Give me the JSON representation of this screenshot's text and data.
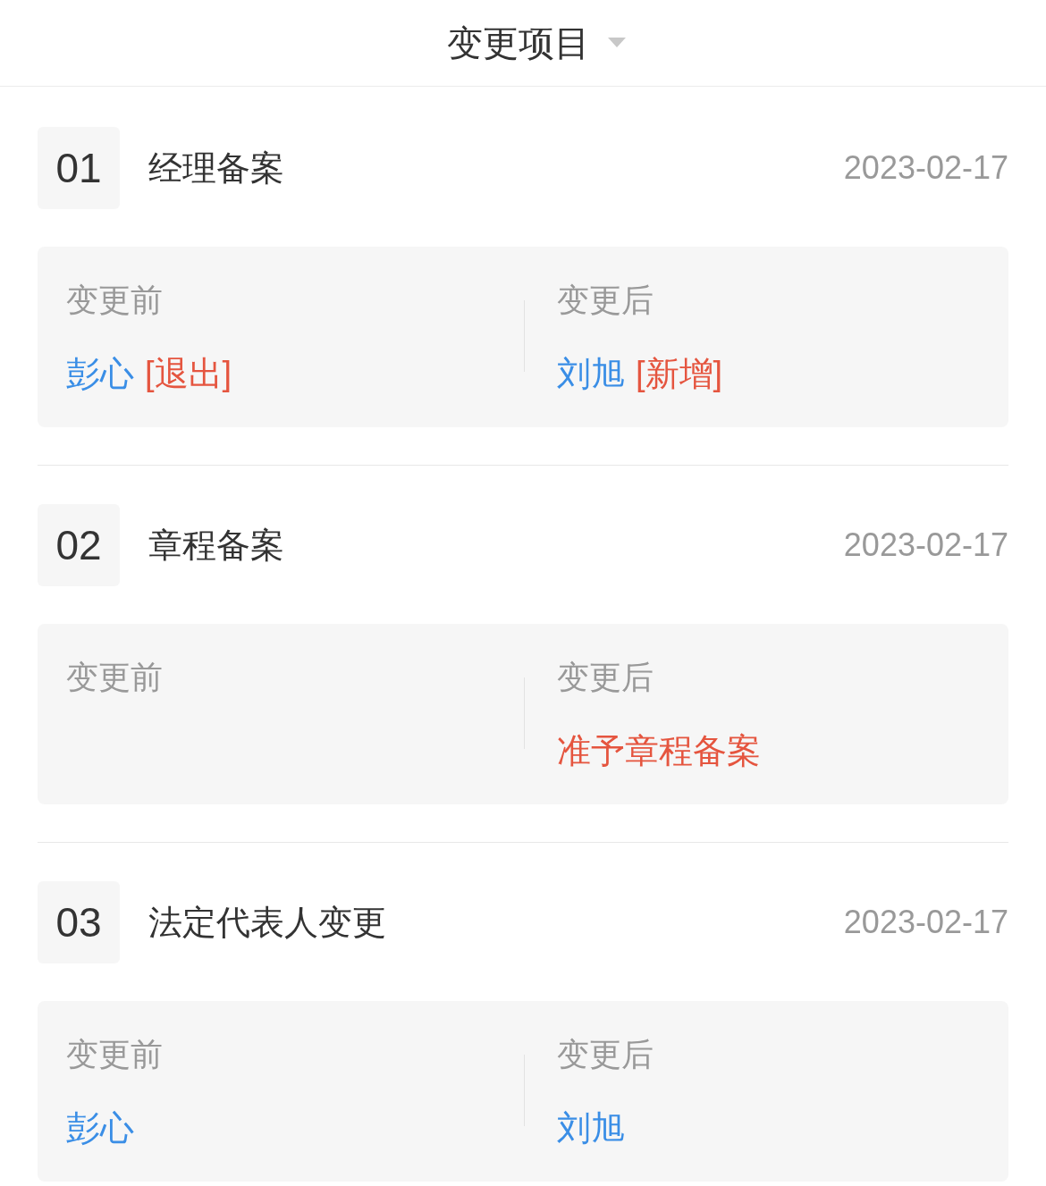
{
  "header": {
    "title": "变更项目"
  },
  "items": [
    {
      "number": "01",
      "title": "经理备案",
      "date": "2023-02-17",
      "before_label": "变更前",
      "after_label": "变更后",
      "before": [
        {
          "text": "彭心",
          "kind": "name"
        },
        {
          "text": "[退出]",
          "kind": "status"
        }
      ],
      "after": [
        {
          "text": "刘旭",
          "kind": "name"
        },
        {
          "text": "[新增]",
          "kind": "status"
        }
      ]
    },
    {
      "number": "02",
      "title": "章程备案",
      "date": "2023-02-17",
      "before_label": "变更前",
      "after_label": "变更后",
      "after": [
        {
          "text": "准予章程备案",
          "kind": "status"
        }
      ]
    },
    {
      "number": "03",
      "title": "法定代表人变更",
      "date": "2023-02-17",
      "before_label": "变更前",
      "after_label": "变更后",
      "before": [
        {
          "text": "彭心",
          "kind": "name"
        }
      ],
      "after": [
        {
          "text": "刘旭",
          "kind": "name"
        }
      ]
    }
  ]
}
